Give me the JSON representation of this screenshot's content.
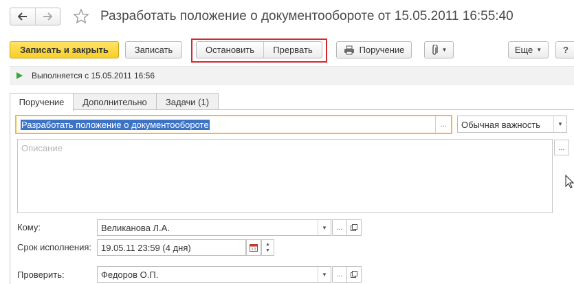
{
  "window": {
    "title": "Разработать положение о документообороте от 15.05.2011 16:55:40"
  },
  "nav": {
    "back_icon": "arrow-left-icon",
    "forward_icon": "arrow-right-icon",
    "favorite_icon": "star-icon"
  },
  "toolbar": {
    "save_close_label": "Записать и закрыть",
    "save_label": "Записать",
    "stop_label": "Остановить",
    "abort_label": "Прервать",
    "order_label": "Поручение",
    "more_label": "Еще"
  },
  "status": {
    "text": "Выполняется с 15.05.2011 16:56",
    "color": "#3aa53a"
  },
  "tabs": [
    {
      "label": "Поручение"
    },
    {
      "label": "Дополнительно"
    },
    {
      "label": "Задачи (1)"
    }
  ],
  "form": {
    "subject_value": "Разработать положение о документообороте",
    "importance_value": "Обычная важность",
    "description_placeholder": "Описание",
    "to_label": "Кому:",
    "to_value": "Великанова Л.А.",
    "deadline_label": "Срок исполнения:",
    "deadline_value": "19.05.11 23:59 (4 дня)",
    "check_label": "Проверить:",
    "check_value": "Федоров О.П.",
    "dots": "..."
  },
  "colors": {
    "accent_yellow": "#f7cf24",
    "focus_border": "#f0bb3c",
    "highlight_box": "#d9262a",
    "selection": "#3d73c5"
  }
}
